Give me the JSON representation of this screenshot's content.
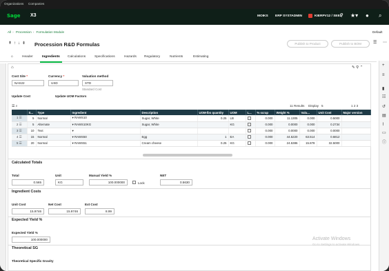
{
  "org_bar": {
    "organizations": "Organizations",
    "companies": "Companies"
  },
  "topbar": {
    "logo": "Sage",
    "app": "X3",
    "folder": "MOIKS",
    "company": "ERP SYSTADMIN",
    "user": "KIERPV12 / SEED"
  },
  "breadcrumb": {
    "all": "All",
    "procession": "Procession",
    "module": "Formulation Module"
  },
  "default_label": "Default",
  "page": {
    "title": "Procession R&D Formulas",
    "publish_product": "Publish to Product",
    "publish_bom": "Publish to BOM"
  },
  "tabs": [
    "Header",
    "Ingredients",
    "Calculations",
    "Specifications",
    "Hazards",
    "Regulatory",
    "Nutrients",
    "Estimating"
  ],
  "form": {
    "cost_site_label": "Cost Site",
    "cost_site_value": "NAS22",
    "currency_label": "Currency",
    "currency_value": "USD",
    "valuation_label": "Valuation method",
    "valuation_value": "STD",
    "valuation_desc": "Standard Cost",
    "update_cost": "Update Cost",
    "update_uom": "Update UOM Factors"
  },
  "grid_toolbar": {
    "results": "11 Results",
    "display_label": "Display",
    "display_value": "5",
    "pages": "1 2 3"
  },
  "grid": {
    "headers": [
      "",
      "S...",
      "Type",
      "Ingredient",
      "Description",
      "UOM-lbs quantity",
      "UOM",
      "L...",
      "% scrap",
      "Weight %",
      "Valu...",
      "Unit Cost",
      "Major version"
    ],
    "rows": [
      {
        "n": "1",
        "seq": "5",
        "type": "Normal",
        "ingredient": "RAWS10",
        "desc": "Sugar, White",
        "qty": "0.25",
        "uom": "LB",
        "scrap": "0.000",
        "weight": "11.1305",
        "valu": "0.000",
        "cost": "0.5000"
      },
      {
        "n": "2",
        "seq": "5",
        "type": "Alternate",
        "ingredient": "RAWS10KG",
        "desc": "Sugar, White",
        "qty": "",
        "uom": "KG",
        "scrap": "0.000",
        "weight": "0.0000",
        "valu": "0.000",
        "cost": "0.2734"
      },
      {
        "n": "3",
        "seq": "10",
        "type": "Text",
        "ingredient": "",
        "desc": "",
        "qty": "",
        "uom": "",
        "scrap": "0.000",
        "weight": "0.0000",
        "valu": "0.000",
        "cost": "0.0000"
      },
      {
        "n": "4",
        "seq": "15",
        "type": "Normal",
        "ingredient": "RAWS50",
        "desc": "Egg",
        "qty": "1",
        "uom": "EA",
        "scrap": "0.000",
        "weight": "44.5220",
        "valu": "63.514",
        "cost": "0.6812"
      },
      {
        "n": "5",
        "seq": "20",
        "type": "Normal",
        "ingredient": "RAWS51",
        "desc": "Cream cheese",
        "qty": "0.25",
        "uom": "KG",
        "scrap": "0.000",
        "weight": "24.5386",
        "valu": "15.878",
        "cost": "32.5000"
      }
    ]
  },
  "calc": {
    "section": "Calculated Totals",
    "total_label": "Total",
    "total_value": "0.565",
    "unit_label": "Unit",
    "unit_value": "KG",
    "manual_label": "Manual Yield %",
    "manual_value": "100.000000",
    "lock_label": "Lock",
    "net_label": "NET",
    "net_value": "0.5630"
  },
  "ingredient_costs": {
    "section": "Ingredient Costs",
    "unit_cost_label": "Unit Cost",
    "unit_cost_value": "15.9746",
    "net_cost_label": "Net Cost",
    "net_cost_value": "15.9746",
    "ext_cost_label": "Ext Cost",
    "ext_cost_value": "8.99"
  },
  "expected_yield": {
    "section": "Expected Yield %",
    "label": "Expected Yield %",
    "value": "100.000000"
  },
  "theoretical": {
    "section": "Theoretical SG",
    "label": "Theoretical Specific Gravity"
  },
  "watermark": {
    "line1": "Activate Windows",
    "line2": "Go to Settings to activate Windows."
  }
}
